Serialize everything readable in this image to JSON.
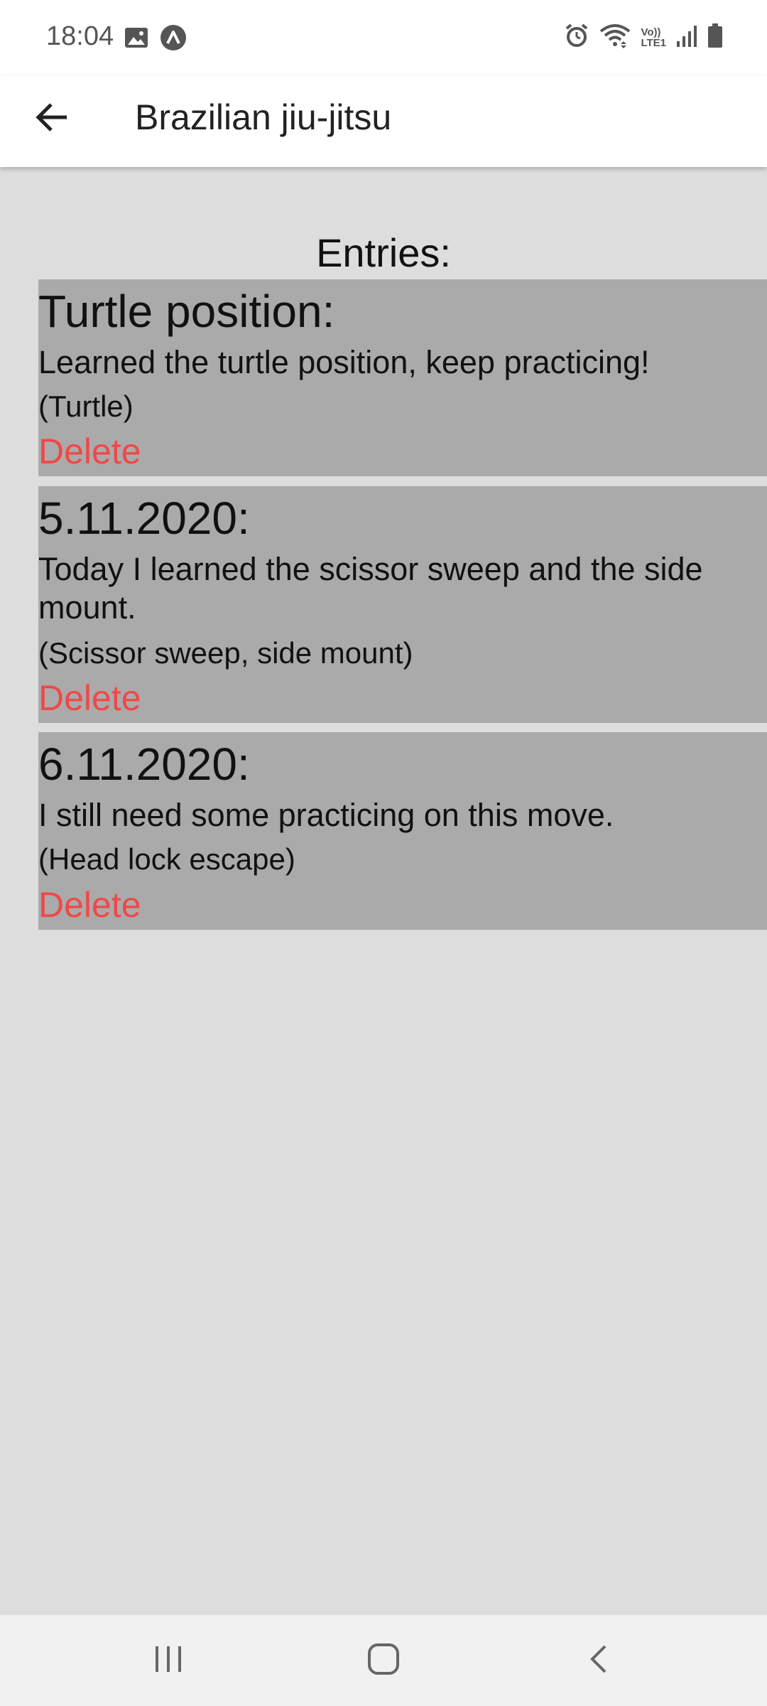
{
  "status_bar": {
    "time": "18:04",
    "left_icons": [
      "image-icon",
      "app-a-icon"
    ],
    "right_icons": [
      "alarm-icon",
      "wifi-icon",
      "volte-icon",
      "signal-icon",
      "battery-icon"
    ],
    "volte_line1": "Vo))",
    "volte_line2": "LTE1"
  },
  "app_bar": {
    "title": "Brazilian jiu-jitsu",
    "back_icon": "arrow-left-icon"
  },
  "content": {
    "heading": "Entries:",
    "entries": [
      {
        "title": "Turtle position:",
        "text": "Learned the turtle position, keep practicing!",
        "tags": "(Turtle)",
        "delete_label": "Delete"
      },
      {
        "title": "5.11.2020:",
        "text": "Today I learned the scissor sweep and the side mount.",
        "tags": "(Scissor sweep, side mount)",
        "delete_label": "Delete"
      },
      {
        "title": "6.11.2020:",
        "text": "I still need some practicing on this move.",
        "tags": "(Head lock escape)",
        "delete_label": "Delete"
      }
    ]
  },
  "nav_bar": {
    "buttons": [
      "recent-apps-icon",
      "home-icon",
      "back-nav-icon"
    ]
  },
  "colors": {
    "background": "#dddddd",
    "entry_background": "#aaaaaa",
    "delete": "#f04848",
    "app_bar": "#ffffff",
    "nav_bar": "#f1f1f1"
  }
}
